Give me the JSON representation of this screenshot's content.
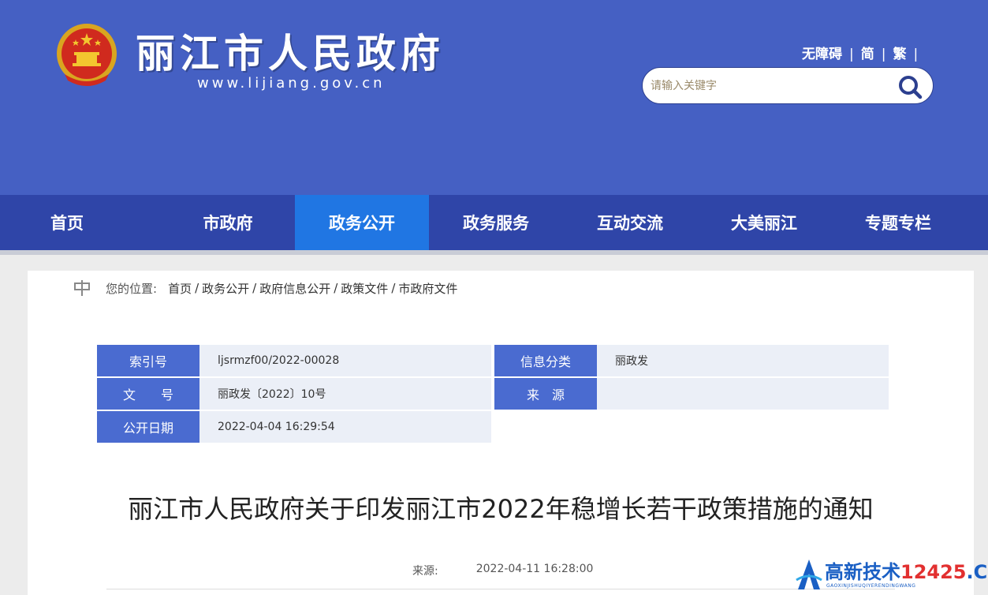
{
  "header": {
    "site_title": "丽江市人民政府",
    "site_url": "www.lijiang.gov.cn",
    "links": [
      "无障碍",
      "简",
      "繁"
    ],
    "search_placeholder": "请输入关键字"
  },
  "nav": {
    "items": [
      "首页",
      "市政府",
      "政务公开",
      "政务服务",
      "互动交流",
      "大美丽江",
      "专题专栏"
    ],
    "active_index": 2
  },
  "breadcrumb": {
    "label": "您的位置:",
    "items": [
      "首页",
      "政务公开",
      "政府信息公开",
      "政策文件",
      "市政府文件"
    ]
  },
  "meta": {
    "index_label": "索引号",
    "index_value": "ljsrmzf00/2022-00028",
    "category_label": "信息分类",
    "category_value": "丽政发",
    "doc_no_label": "文　　号",
    "doc_no_value": "丽政发〔2022〕10号",
    "source_label": "来　源",
    "source_value": "",
    "date_label": "公开日期",
    "date_value": "2022-04-04 16:29:54"
  },
  "document": {
    "title": "丽江市人民政府关于印发丽江市2022年稳增长若干政策措施的通知",
    "source_label": "来源:",
    "date": "2022-04-11 16:28:00"
  },
  "watermark": {
    "text_main": "高新技术",
    "text_num": "12425",
    "text_suffix": ".CN",
    "sub": "GAOXINJISHUQIYERENDINGWANG"
  },
  "colors": {
    "header_bg": "#4560c3",
    "nav_bg": "#2f45a8",
    "nav_active": "#2076e3",
    "meta_label_bg": "#4a6bd0"
  }
}
